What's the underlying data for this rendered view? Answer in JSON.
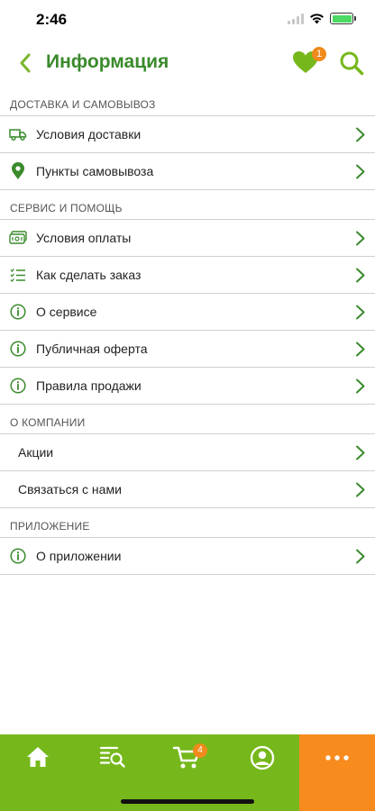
{
  "status_bar": {
    "time": "2:46"
  },
  "header": {
    "title": "Информация",
    "favorites_count": "1"
  },
  "sections": [
    {
      "title": "ДОСТАВКА И САМОВЫВОЗ",
      "items": [
        {
          "label": "Условия доставки",
          "icon": "truck-icon"
        },
        {
          "label": "Пункты самовывоза",
          "icon": "location-pin-icon"
        }
      ]
    },
    {
      "title": "СЕРВИС И ПОМОЩЬ",
      "items": [
        {
          "label": "Условия оплаты",
          "icon": "payment-card-icon"
        },
        {
          "label": "Как сделать заказ",
          "icon": "checklist-icon"
        },
        {
          "label": "О сервисе",
          "icon": "info-icon"
        },
        {
          "label": "Публичная оферта",
          "icon": "info-icon"
        },
        {
          "label": "Правила продажи",
          "icon": "info-icon"
        }
      ]
    },
    {
      "title": "О КОМПАНИИ",
      "items": [
        {
          "label": "Акции"
        },
        {
          "label": "Связаться с нами"
        }
      ]
    },
    {
      "title": "ПРИЛОЖЕНИЕ",
      "items": [
        {
          "label": "О приложении",
          "icon": "info-icon"
        }
      ]
    }
  ],
  "tabbar": {
    "cart_count": "4"
  },
  "colors": {
    "accent_green": "#3a8a2c",
    "tab_green": "#76b81c",
    "tab_orange": "#f78b1e",
    "badge_orange": "#f08a1c"
  }
}
